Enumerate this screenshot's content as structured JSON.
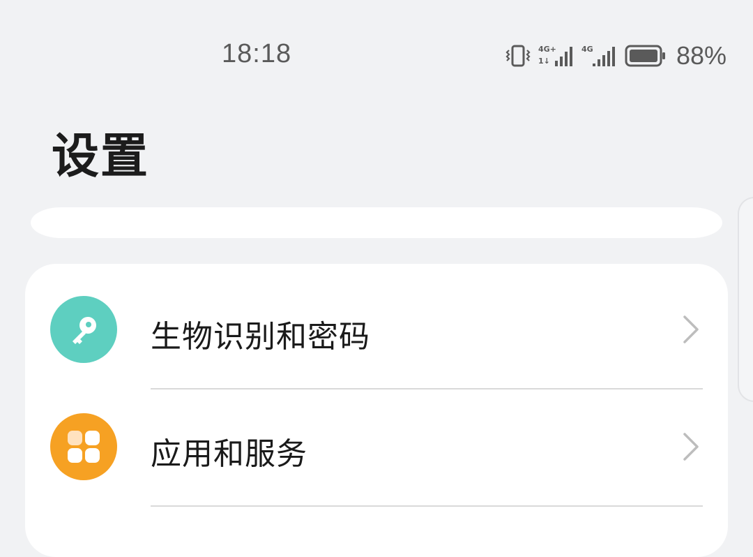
{
  "status_bar": {
    "time": "18:18",
    "battery_percent": "88%",
    "icons": [
      "vibrate-icon",
      "signal-4g-plus-icon",
      "signal-4g-icon",
      "battery-icon"
    ]
  },
  "page": {
    "title": "设置"
  },
  "settings": {
    "items": [
      {
        "label": "生物识别和密码",
        "icon": "key-icon",
        "icon_color": "#5ecfc0"
      },
      {
        "label": "应用和服务",
        "icon": "apps-grid-icon",
        "icon_color": "#f6a123"
      }
    ]
  }
}
